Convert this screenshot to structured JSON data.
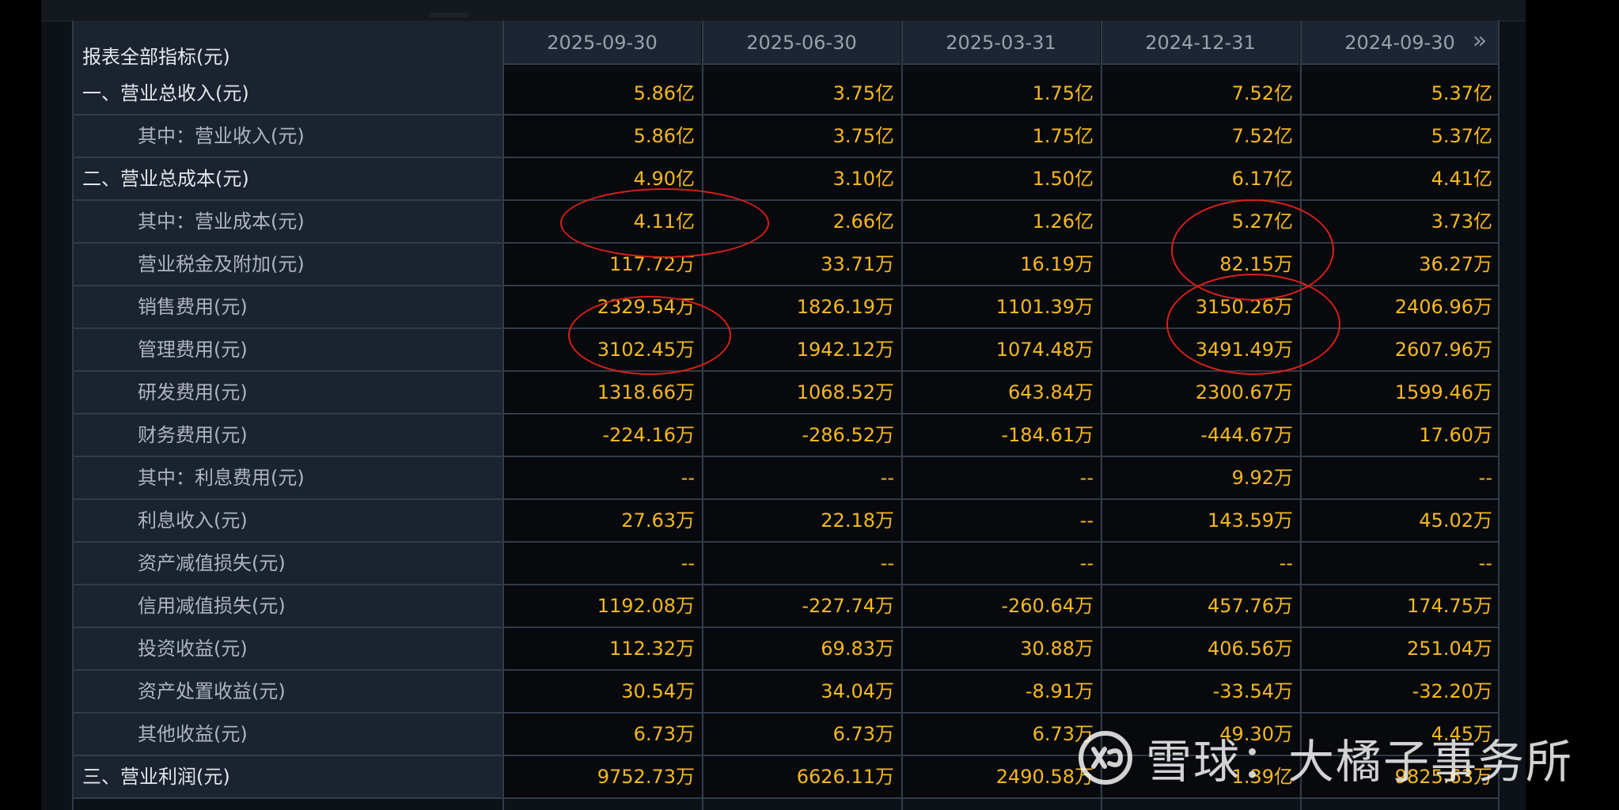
{
  "header": {
    "label": "报表全部指标(元)",
    "dates": [
      "2025-09-30",
      "2025-06-30",
      "2025-03-31",
      "2024-12-31",
      "2024-09-30"
    ]
  },
  "rows": [
    {
      "label": "一、营业总收入(元)",
      "level": "top",
      "values": [
        "5.86亿",
        "3.75亿",
        "1.75亿",
        "7.52亿",
        "5.37亿"
      ]
    },
    {
      "label": "其中：营业收入(元)",
      "level": "sub",
      "values": [
        "5.86亿",
        "3.75亿",
        "1.75亿",
        "7.52亿",
        "5.37亿"
      ]
    },
    {
      "label": "二、营业总成本(元)",
      "level": "top",
      "values": [
        "4.90亿",
        "3.10亿",
        "1.50亿",
        "6.17亿",
        "4.41亿"
      ]
    },
    {
      "label": "其中：营业成本(元)",
      "level": "sub",
      "values": [
        "4.11亿",
        "2.66亿",
        "1.26亿",
        "5.27亿",
        "3.73亿"
      ]
    },
    {
      "label": "营业税金及附加(元)",
      "level": "sub",
      "values": [
        "117.72万",
        "33.71万",
        "16.19万",
        "82.15万",
        "36.27万"
      ]
    },
    {
      "label": "销售费用(元)",
      "level": "sub",
      "values": [
        "2329.54万",
        "1826.19万",
        "1101.39万",
        "3150.26万",
        "2406.96万"
      ]
    },
    {
      "label": "管理费用(元)",
      "level": "sub",
      "values": [
        "3102.45万",
        "1942.12万",
        "1074.48万",
        "3491.49万",
        "2607.96万"
      ]
    },
    {
      "label": "研发费用(元)",
      "level": "sub",
      "values": [
        "1318.66万",
        "1068.52万",
        "643.84万",
        "2300.67万",
        "1599.46万"
      ]
    },
    {
      "label": "财务费用(元)",
      "level": "sub",
      "values": [
        "-224.16万",
        "-286.52万",
        "-184.61万",
        "-444.67万",
        "17.60万"
      ]
    },
    {
      "label": "其中：利息费用(元)",
      "level": "sub",
      "values": [
        "--",
        "--",
        "--",
        "9.92万",
        "--"
      ]
    },
    {
      "label": "利息收入(元)",
      "level": "sub",
      "values": [
        "27.63万",
        "22.18万",
        "--",
        "143.59万",
        "45.02万"
      ]
    },
    {
      "label": "资产减值损失(元)",
      "level": "sub",
      "values": [
        "--",
        "--",
        "--",
        "--",
        "--"
      ]
    },
    {
      "label": "信用减值损失(元)",
      "level": "sub",
      "values": [
        "1192.08万",
        "-227.74万",
        "-260.64万",
        "457.76万",
        "174.75万"
      ]
    },
    {
      "label": "投资收益(元)",
      "level": "sub",
      "values": [
        "112.32万",
        "69.83万",
        "30.88万",
        "406.56万",
        "251.04万"
      ]
    },
    {
      "label": "资产处置收益(元)",
      "level": "sub",
      "values": [
        "30.54万",
        "34.04万",
        "-8.91万",
        "-33.54万",
        "-32.20万"
      ]
    },
    {
      "label": "其他收益(元)",
      "level": "sub",
      "values": [
        "6.73万",
        "6.73万",
        "6.73万",
        "49.30万",
        "4.45万"
      ]
    },
    {
      "label": "三、营业利润(元)",
      "level": "top",
      "values": [
        "9752.73万",
        "6626.11万",
        "2490.58万",
        "1.39亿",
        "9825.63万"
      ]
    }
  ],
  "watermark": {
    "text": "雪球：大橘子事务所",
    "icon": "xueqiu-logo-icon"
  },
  "nav": {
    "next_icon": "double-chevron-right-icon"
  },
  "colors": {
    "value": "#f5b81e",
    "annotation": "#d8201a",
    "label_bg": "#1b2330",
    "header_bg": "#1c2533"
  }
}
